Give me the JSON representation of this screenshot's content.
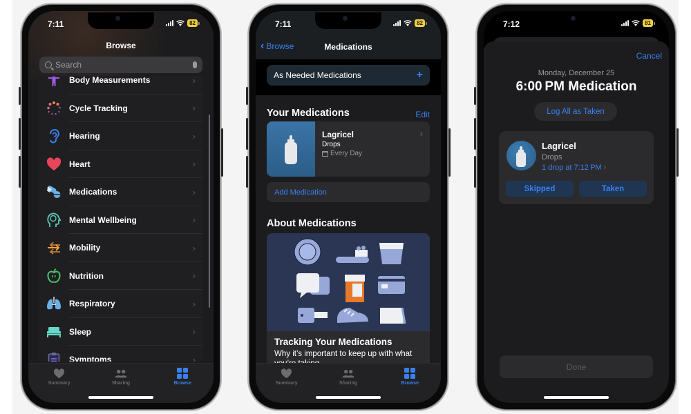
{
  "phones": [
    {
      "status": {
        "time": "7:11",
        "battery": "82"
      },
      "screen": "browse",
      "nav_title": "Browse",
      "search_placeholder": "Search",
      "categories": [
        {
          "label": "Body Measurements",
          "icon": "body-measurements-icon",
          "color": "#9b5de5"
        },
        {
          "label": "Cycle Tracking",
          "icon": "cycle-tracking-icon",
          "color": "#f07858"
        },
        {
          "label": "Hearing",
          "icon": "hearing-icon",
          "color": "#3a80f0"
        },
        {
          "label": "Heart",
          "icon": "heart-icon",
          "color": "#e8455a"
        },
        {
          "label": "Medications",
          "icon": "medications-icon",
          "color": "#6ab0e8"
        },
        {
          "label": "Mental Wellbeing",
          "icon": "mental-wellbeing-icon",
          "color": "#5cc8b8"
        },
        {
          "label": "Mobility",
          "icon": "mobility-icon",
          "color": "#f0a040"
        },
        {
          "label": "Nutrition",
          "icon": "nutrition-icon",
          "color": "#4cc068"
        },
        {
          "label": "Respiratory",
          "icon": "respiratory-icon",
          "color": "#6ab0e8"
        },
        {
          "label": "Sleep",
          "icon": "sleep-icon",
          "color": "#6ad8c8"
        },
        {
          "label": "Symptoms",
          "icon": "symptoms-icon",
          "color": "#6a6af0"
        }
      ]
    },
    {
      "status": {
        "time": "7:11",
        "battery": "82"
      },
      "screen": "medications",
      "back_label": "Browse",
      "nav_title": "Medications",
      "as_needed_label": "As Needed Medications",
      "your_medications_title": "Your Medications",
      "edit_label": "Edit",
      "medication": {
        "name": "Lagricel",
        "form": "Drops",
        "schedule": "Every Day"
      },
      "add_medication_label": "Add Medication",
      "about_title": "About Medications",
      "article": {
        "title": "Tracking Your Medications",
        "description": "Why it’s important to keep up with what you’re taking."
      }
    },
    {
      "status": {
        "time": "7:12",
        "battery": "81"
      },
      "screen": "log-dose",
      "cancel_label": "Cancel",
      "date": "Monday, December 25",
      "title": "6:00 PM Medication",
      "log_all_label": "Log All as Taken",
      "dose": {
        "name": "Lagricel",
        "form": "Drops",
        "detail": "1 drop at 7:12 PM"
      },
      "skipped_label": "Skipped",
      "taken_label": "Taken",
      "done_label": "Done"
    }
  ],
  "tabbar": {
    "tabs": [
      {
        "label": "Summary",
        "icon": "heart-icon",
        "active": false
      },
      {
        "label": "Sharing",
        "icon": "people-icon",
        "active": false
      },
      {
        "label": "Browse",
        "icon": "grid-icon",
        "active": true
      }
    ]
  },
  "colors": {
    "accent": "#3a80f0",
    "battery": "#f1cf3e",
    "background": "#1c1c1e"
  }
}
